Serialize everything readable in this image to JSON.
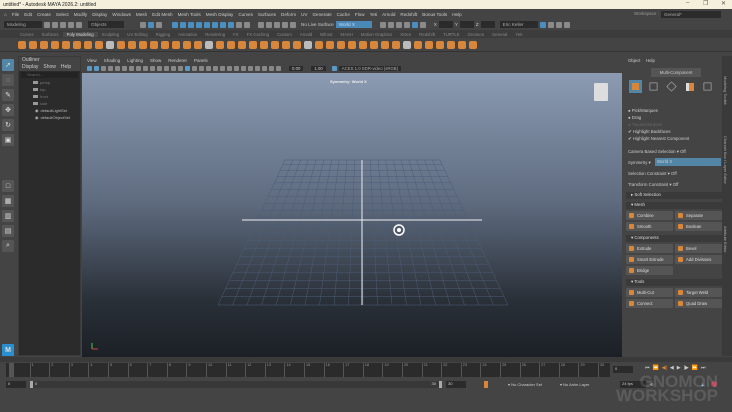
{
  "window": {
    "title": "untitled* - Autodesk MAYA 2026.2: untitled",
    "controls": [
      "–",
      "❐",
      "✕"
    ]
  },
  "menubar": [
    "File",
    "Edit",
    "Create",
    "Select",
    "Modify",
    "Display",
    "Windows",
    "Mesh",
    "Edit Mesh",
    "Mesh Tools",
    "Mesh Display",
    "Curves",
    "Surfaces",
    "Deform",
    "UV",
    "Generate",
    "Cache",
    "Flow",
    "Yeti",
    "Arnold",
    "Redshift",
    "Bonus Tools",
    "Help"
  ],
  "workspace": {
    "label": "Workspace :",
    "value": "General*"
  },
  "status": {
    "menuset": "Modeling",
    "objects": "Objects",
    "live": "No Live Surface",
    "symmetry": "World X",
    "x": "X",
    "y": "Y",
    "z": "Z",
    "user": "Eric Keller"
  },
  "shelf_tabs": [
    "Curves",
    "Surfaces",
    "Poly Modeling",
    "Sculpting",
    "UV Editing",
    "Rigging",
    "Animation",
    "Rendering",
    "FX",
    "FX Caching",
    "Custom",
    "Arnold",
    "Bifrost",
    "MASH",
    "Motion Graphics",
    "XGen",
    "Redshift",
    "TURTLE",
    "Gnomon",
    "General",
    "Yeti"
  ],
  "shelf_active": 2,
  "outliner": {
    "title": "Outliner",
    "menu": [
      "Display",
      "Show",
      "Help"
    ],
    "search": "Search...",
    "items": [
      "persp",
      "top",
      "front",
      "side"
    ],
    "sets": [
      "defaultLightSet",
      "defaultObjectSet"
    ]
  },
  "viewport": {
    "menu": [
      "View",
      "Shading",
      "Lighting",
      "Show",
      "Renderer",
      "Panels"
    ],
    "exposure": "0.00",
    "gamma": "1.00",
    "colorspace": "ACES 1.0 SDR-video (sRGB)",
    "symmetry_label": "Symmetry: World X"
  },
  "toolkit": {
    "menu": [
      "Object",
      "Help"
    ],
    "mode": "Multi-Component",
    "pick": "Pick/Marquee",
    "drag": "Drag",
    "tweak": "Tweak/Marquee",
    "backfaces": "Highlight Backfaces",
    "nearest": "Highlight Nearest Component",
    "camera_sel": "Camera Based Selection",
    "camera_sel_val": "Off",
    "symmetry": "Symmetry",
    "symmetry_val": "World X",
    "sel_constraint": "Selection Constraint",
    "sel_constraint_val": "Off",
    "xf_constraint": "Transform Constraint",
    "xf_constraint_val": "Off",
    "soft": "Soft Selection",
    "sections": [
      {
        "title": "Mesh",
        "buttons": [
          "Combine",
          "Separate",
          "Smooth",
          "Boolean"
        ]
      },
      {
        "title": "Components",
        "buttons": [
          "Extrude",
          "Bevel",
          "Smart Extrude",
          "Add Divisions",
          "Bridge"
        ]
      },
      {
        "title": "Tools",
        "buttons": [
          "Multi-Cut",
          "Target Weld",
          "Connect",
          "Quad Draw"
        ]
      }
    ]
  },
  "vertical_tabs": [
    "Modeling Toolkit",
    "Channel Box / Layer Editor",
    "Attribute Editor"
  ],
  "timeline": {
    "start": 1,
    "end": 30,
    "current": "0",
    "range_start": "0",
    "inner_start": "0",
    "inner_end": "30",
    "range_end": "30",
    "character_set": "No Character Set",
    "anim_layer": "No Anim Layer",
    "fps": "24 fps"
  },
  "watermark": "THE GNOMON WORKSHOP"
}
